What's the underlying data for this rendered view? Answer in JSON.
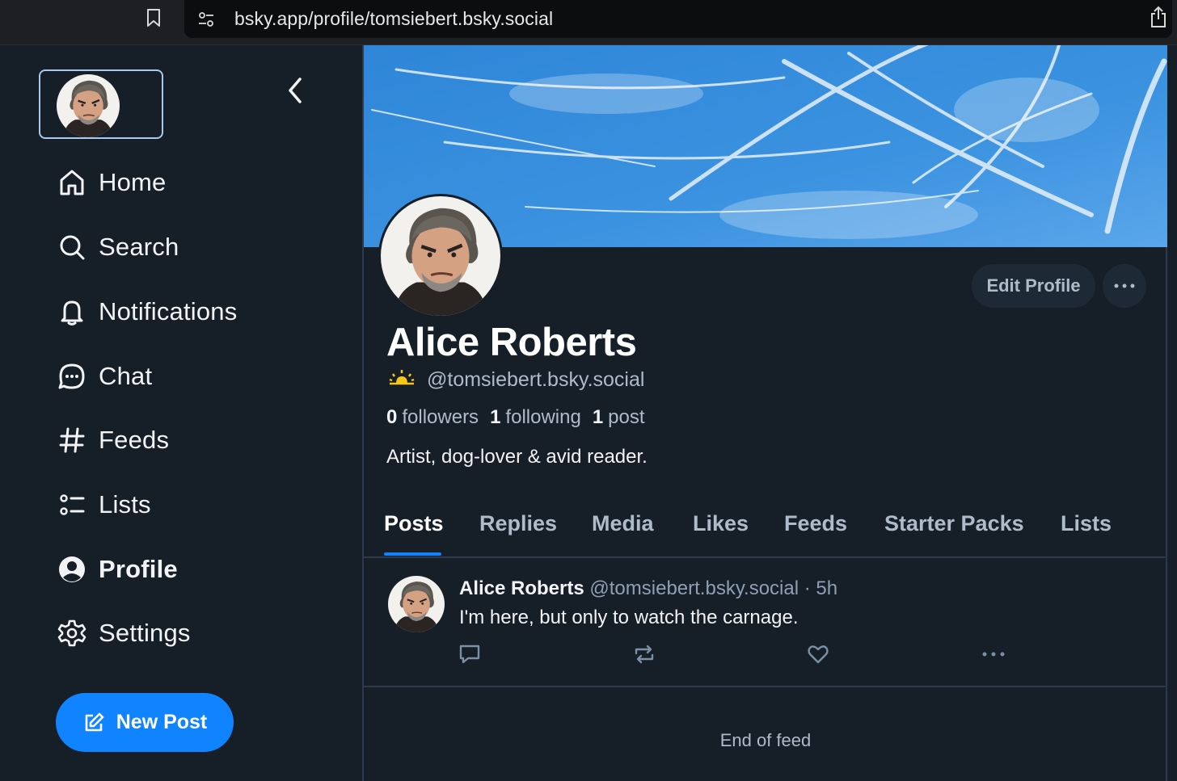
{
  "browser": {
    "url": "bsky.app/profile/tomsiebert.bsky.social"
  },
  "sidebar": {
    "items": [
      {
        "label": "Home",
        "icon": "home-icon"
      },
      {
        "label": "Search",
        "icon": "search-icon"
      },
      {
        "label": "Notifications",
        "icon": "bell-icon"
      },
      {
        "label": "Chat",
        "icon": "chat-bubble-icon"
      },
      {
        "label": "Feeds",
        "icon": "hash-icon"
      },
      {
        "label": "Lists",
        "icon": "list-icon"
      },
      {
        "label": "Profile",
        "icon": "user-circle-icon",
        "active": true
      },
      {
        "label": "Settings",
        "icon": "gear-icon"
      }
    ],
    "new_post_label": "New Post"
  },
  "profile": {
    "display_name": "Alice Roberts",
    "handle": "@tomsiebert.bsky.social",
    "followers_count": "0",
    "followers_label": "followers",
    "following_count": "1",
    "following_label": "following",
    "posts_count": "1",
    "posts_label": "post",
    "bio": "Artist, dog-lover & avid reader.",
    "edit_profile_label": "Edit Profile"
  },
  "tabs": [
    "Posts",
    "Replies",
    "Media",
    "Likes",
    "Feeds",
    "Starter Packs",
    "Lists"
  ],
  "active_tab": "Posts",
  "post": {
    "author": "Alice Roberts",
    "handle": "@tomsiebert.bsky.social",
    "time": "5h",
    "text": "I'm here, but only to watch the carnage."
  },
  "end_of_feed": "End of feed",
  "colors": {
    "background": "#161e27",
    "accent": "#1083fe",
    "muted_text": "#aebbc9",
    "border": "#2c3a4b"
  }
}
